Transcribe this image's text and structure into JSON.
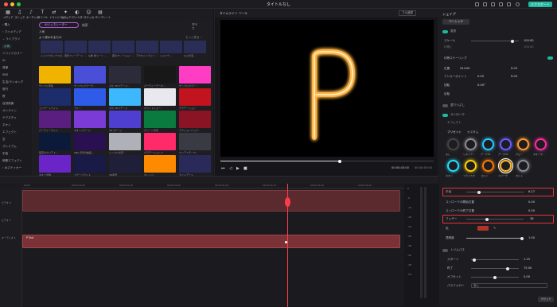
{
  "window": {
    "title": "タイトルなし",
    "export_label": "エクスポート"
  },
  "toolbar": {
    "tools": [
      {
        "icon": "media-icon",
        "glyph": "▦",
        "label": "メディア"
      },
      {
        "icon": "stock-icon",
        "glyph": "♫",
        "label": "ストック"
      },
      {
        "icon": "audio-icon",
        "glyph": "♪",
        "label": "オーディオ"
      },
      {
        "icon": "title-icon",
        "glyph": "T",
        "label": "タイトル"
      },
      {
        "icon": "transition-icon",
        "glyph": "⇄",
        "label": "トランジション"
      },
      {
        "icon": "effect-icon",
        "glyph": "✦",
        "label": "エフェクト"
      },
      {
        "icon": "filter-icon",
        "glyph": "◐",
        "label": "フィルター"
      },
      {
        "icon": "sticker-icon",
        "glyph": "☺",
        "label": "ステッカー"
      },
      {
        "icon": "template-icon",
        "glyph": "▤",
        "label": "テンプレート"
      }
    ]
  },
  "sidebar": {
    "items": [
      {
        "label": "› 購入",
        "active": false
      },
      {
        "label": "› マイメディア",
        "active": false
      },
      {
        "label": "⌄ ライブラリ",
        "active": false
      },
      {
        "label": "人気",
        "active": true
      },
      {
        "label": "ソリッドカラー",
        "active": false
      },
      {
        "label": "AI",
        "active": false
      },
      {
        "label": "背景",
        "active": false
      },
      {
        "label": "SNS",
        "active": false
      },
      {
        "label": "生活/ランキング",
        "active": false
      },
      {
        "label": "旅行",
        "active": false
      },
      {
        "label": "夜",
        "active": false
      },
      {
        "label": "自然風景",
        "active": false
      },
      {
        "label": "オンライン",
        "active": false
      },
      {
        "label": "テクスチャ",
        "active": false
      },
      {
        "label": "ネオン",
        "active": false
      },
      {
        "label": "エフェクト",
        "active": false
      },
      {
        "label": "空",
        "active": false
      },
      {
        "label": "プレミアム",
        "active": false
      },
      {
        "label": "宇宙",
        "active": false
      },
      {
        "label": "映像エフェクト",
        "active": false
      },
      {
        "label": "› AIステッカー",
        "active": false
      }
    ]
  },
  "media": {
    "ai_button": "AIジェネレーター",
    "search_text": "検索",
    "all_label": "すべて",
    "section_popular": "人気",
    "section_recent": "よく使われるもの",
    "more_label": "もっと見る ›",
    "recent": [
      {
        "label": "シャドウボックスの..."
      },
      {
        "label": "風景フリーアート ..."
      },
      {
        "label": "仏教 紙トーン ..."
      },
      {
        "label": "夢のナレーション ..."
      },
      {
        "label": "アクセントライン ..."
      },
      {
        "label": "シャドウ ..."
      },
      {
        "label": "ロゴの変..."
      }
    ],
    "grid": [
      {
        "label": "サンプル黄色",
        "color": "#f0b400"
      },
      {
        "label": "サンプルカラーヴ...",
        "color": "#4a4fd8"
      },
      {
        "label": "人気 3Dステージ...",
        "color": "#2b2b3a"
      },
      {
        "label": "パーティーテーマ...",
        "color": "#181818"
      },
      {
        "label": "サンプルカラー...",
        "color": "#ff3cc4"
      },
      {
        "label": "コンサートライト",
        "color": "#1d2c6a"
      },
      {
        "label": "ブルー",
        "color": "#2e5be8"
      },
      {
        "label": "人気 3Dステージ",
        "color": "#3db8ff"
      },
      {
        "label": "ホワイトショー",
        "color": "#e8e8ee"
      },
      {
        "label": "グラデーション",
        "color": "#c1141f"
      },
      {
        "label": "パーティーライト",
        "color": "#5a1e80"
      },
      {
        "label": "ネオンステージ",
        "color": "#7b3bd6"
      },
      {
        "label": "3Dステージ",
        "color": "#4e3fd0"
      },
      {
        "label": "グリーン背景",
        "color": "#0a7a3e"
      },
      {
        "label": "アクションバック...",
        "color": "#8a1424"
      },
      {
        "label": "夜空のクリアト...",
        "color": "#0c1a3a"
      },
      {
        "label": "SNS 背景の動画...",
        "color": "#2a1050"
      },
      {
        "label": "シンプル光沢...",
        "color": "#b0b0b8"
      },
      {
        "label": "グラデーション 2",
        "color": "#ff2a6a"
      },
      {
        "label": "クリアスモーク...",
        "color": "#3a3a44"
      },
      {
        "label": "ネオン光線",
        "color": "#6a24c8"
      },
      {
        "label": "ステージライト",
        "color": "#1a1a46"
      },
      {
        "label": "3D夜景",
        "color": "#1f1f3a"
      },
      {
        "label": "オレンジ",
        "color": "#ff8a00"
      },
      {
        "label": "ナイトアート",
        "color": "#2a2a5a"
      }
    ]
  },
  "preview": {
    "tab1": "タイムライン",
    "tab2": "ツール",
    "quality": "フル品質",
    "time_current": "00:00:03:00",
    "time_total": "00:00:05:00",
    "glyph": "P"
  },
  "timeline": {
    "ruler_marks": [
      "00:00",
      "00:00:00:20",
      "00:00:01:10",
      "00:00:02:00",
      "00:00:02:20",
      "00:00:03:10",
      "00:00:04:00",
      "00:00:04:20"
    ],
    "tracks": [
      {
        "label": "ビデオ 2"
      },
      {
        "label": "ビデオ 1"
      },
      {
        "label": "オーディオ 1"
      }
    ],
    "clip_label": "P Text",
    "meter_labels": [
      "0",
      "-6",
      "-12",
      "-18",
      "-24",
      "-30",
      "-36",
      "-42",
      "-48",
      "-54"
    ]
  },
  "properties": {
    "tab": "シェイプ",
    "subtab": "ベーシック",
    "transform_label": "変形",
    "scale_label": "スケール",
    "scale_value": "100.00",
    "uniform_label": "均等に",
    "uniform_value": "100.00",
    "uniform_scale": "均等スケーリング",
    "position_label": "位置",
    "pos_x": "243.00",
    "pos_y": "0.00",
    "anchor_label": "アンカーポイント",
    "anchor_x": "0.00",
    "anchor_y": "0.00",
    "rotate_label": "回転",
    "rotate_value": "0.00°",
    "flip_label": "反転",
    "fill_label": "塗りつぶし",
    "stroke_label": "ストローク",
    "effect_tab": "エフェクト",
    "preset_tab": "プリセット",
    "custom_tab": "カスタム",
    "presets": [
      {
        "label": "なし",
        "color": "#444"
      },
      {
        "label": "リタイア...",
        "color": "#8a8a90"
      },
      {
        "label": "アーク01",
        "color": "#2cc8ff"
      },
      {
        "label": "アーク02",
        "color": "#6a5cff"
      },
      {
        "label": "グロー",
        "color": "#ff9a2c"
      },
      {
        "label": "ネオンサ...",
        "color": "#ff2aa0"
      },
      {
        "label": "ネオン",
        "color": "#22e0ff"
      },
      {
        "label": "フライスタ",
        "color": "#ffd400"
      },
      {
        "label": "ゴルド",
        "color": "#ff7a00"
      },
      {
        "label": "スパーク",
        "color": "#ffb82c"
      },
      {
        "label": "ボルト",
        "color": "#8c8c96"
      }
    ],
    "width_label": "半径",
    "width_value": "6.27",
    "start_label": "ストロークの開始位置",
    "start_value": "0.00",
    "end_label": "ストロークの終了位置",
    "end_value": "0.00",
    "feather_label": "フェザー",
    "feather_value": "36",
    "color_label": "色",
    "color_hex": "#b03428",
    "opacity_label": "透明度",
    "opacity_value": "1.00",
    "animation_label": "トリムパス",
    "start2_label": "スタート",
    "start2_value": "1.15",
    "end2_label": "終了",
    "end2_value": "75.00",
    "offset_label": "オフセット",
    "offset_value": "0.00",
    "path_label": "パスフォロー",
    "path_value": "なし",
    "reset_label": "リセット"
  }
}
